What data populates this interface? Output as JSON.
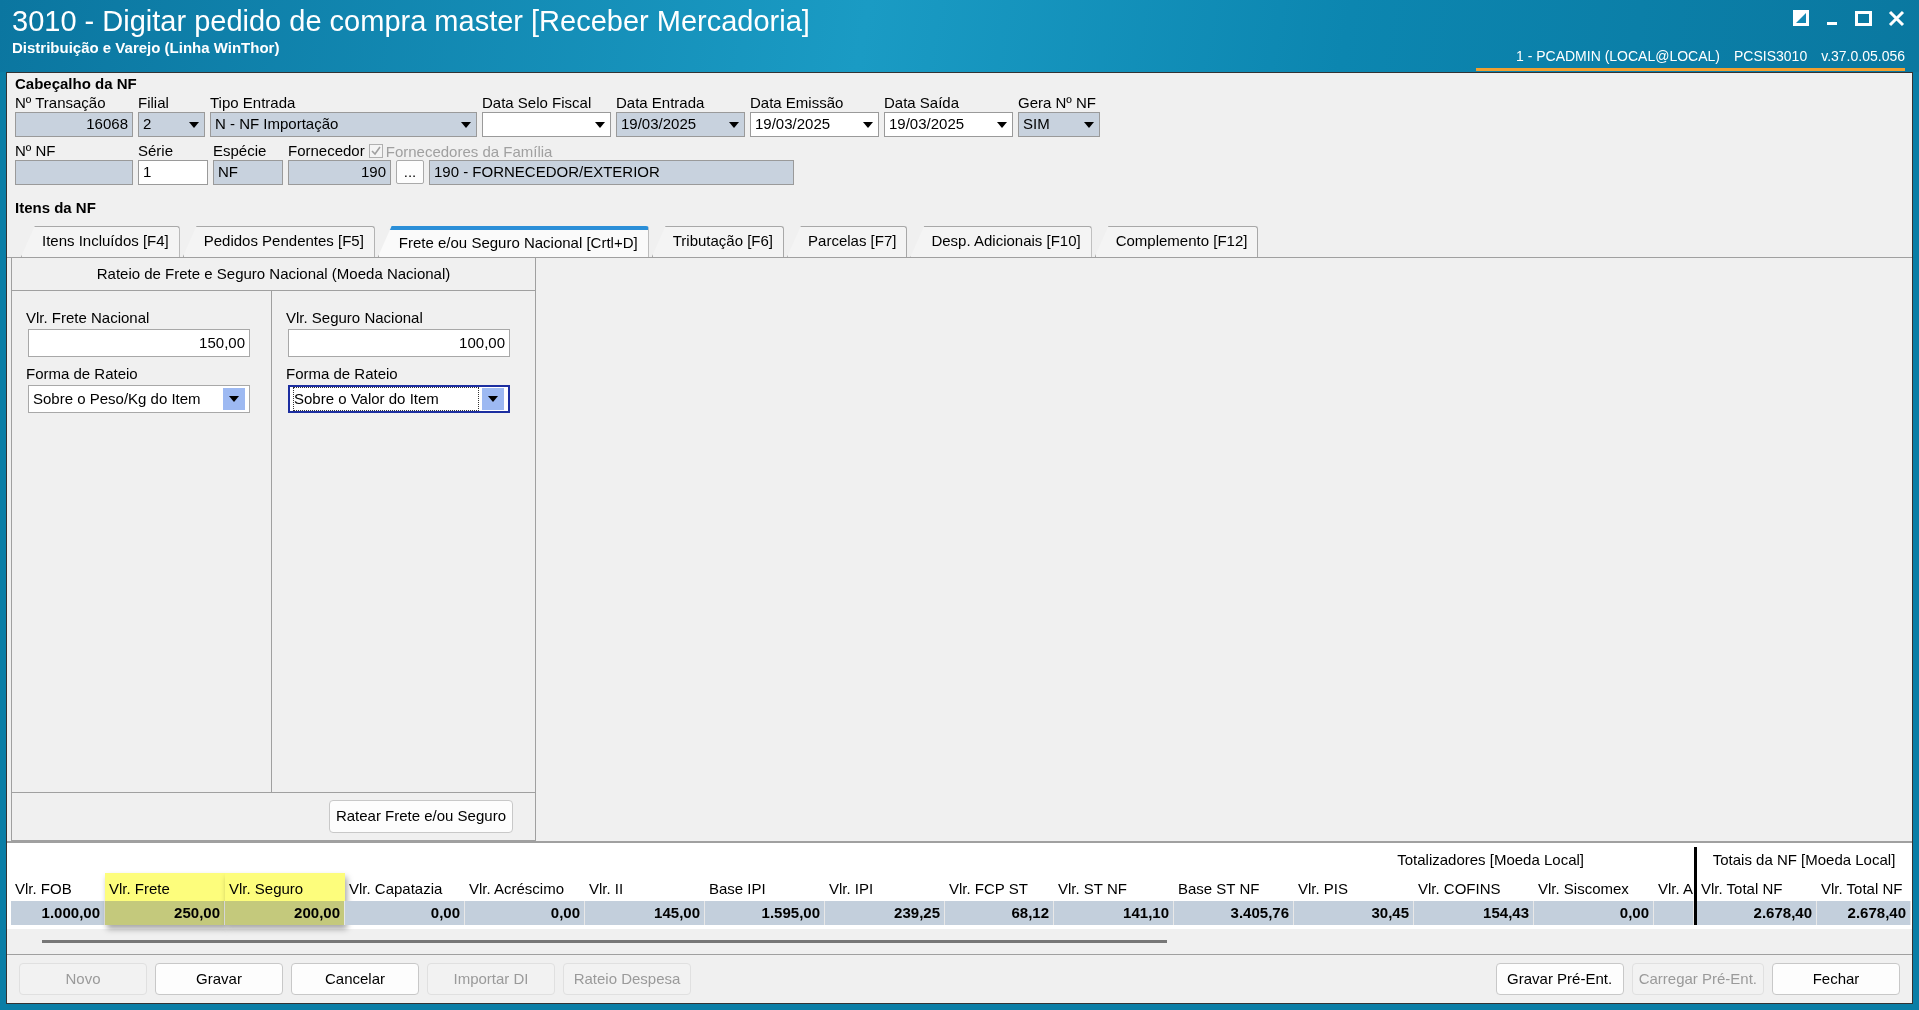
{
  "window": {
    "title": "3010 - Digitar pedido de compra master [Receber Mercadoria]",
    "subtitle": "Distribuição e Varejo (Linha WinThor)",
    "session": "1 - PCADMIN (LOCAL@LOCAL)",
    "program": "PCSIS3010",
    "version": "v.37.0.05.056"
  },
  "header": {
    "title": "Cabeçalho da NF",
    "row_1": [
      {
        "label": "Nº Transação",
        "value": "16068",
        "kind": "number",
        "readonly": true
      },
      {
        "label": "Filial",
        "value": "2",
        "kind": "combo",
        "readonly": true
      },
      {
        "label": "Tipo Entrada",
        "value": "N - NF Importação",
        "kind": "combo",
        "readonly": true
      },
      {
        "label": "Data Selo Fiscal",
        "kind": "combo",
        "readonly": false
      },
      {
        "label": "Data Entrada",
        "value": "19/03/2025",
        "kind": "combo",
        "readonly": true
      },
      {
        "label": "Data Emissão",
        "value": "19/03/2025",
        "kind": "combo",
        "readonly": false
      },
      {
        "label": "Data Saída",
        "value": "19/03/2025",
        "kind": "combo",
        "readonly": false
      },
      {
        "label": "Gera Nº NF",
        "value": "SIM",
        "kind": "combo",
        "readonly": true
      }
    ],
    "row_2": [
      {
        "label": "Nº NF",
        "kind": "text",
        "readonly": true
      },
      {
        "label": "Série",
        "value": "1",
        "kind": "text",
        "readonly": false
      },
      {
        "label": "Espécie",
        "value": "NF",
        "kind": "text",
        "readonly": true
      },
      {
        "label": "Fornecedor",
        "value": "190",
        "kind": "number",
        "readonly": true,
        "checkbox": {
          "label": "Fornecedores da Família",
          "checked": true,
          "disabled": true
        }
      },
      {
        "value": "...",
        "kind": "button"
      },
      {
        "value": "190 - FORNECEDOR/EXTERIOR",
        "kind": "text",
        "readonly": true
      }
    ]
  },
  "items_title": "Itens da NF",
  "tabs": [
    {
      "label": "Itens Incluídos [F4]",
      "selected": false
    },
    {
      "label": "Pedidos Pendentes [F5]",
      "selected": false
    },
    {
      "label": "Frete e/ou Seguro Nacional [Crtl+D]",
      "selected": true
    },
    {
      "label": "Tributação [F6]",
      "selected": false
    },
    {
      "label": "Parcelas [F7]",
      "selected": false
    },
    {
      "label": "Desp. Adicionais [F10]",
      "selected": false
    },
    {
      "label": "Complemento [F12]",
      "selected": false
    }
  ],
  "panel": {
    "title": "Rateio de Frete e Seguro Nacional (Moeda Nacional)",
    "columns": [
      {
        "label": "Vlr. Frete Nacional",
        "value": "150,00",
        "method_label": "Forma de Rateio",
        "method_value": "Sobre o Peso/Kg do Item",
        "focused": false
      },
      {
        "label": "Vlr. Seguro Nacional",
        "value": "100,00",
        "method_label": "Forma de Rateio",
        "method_value": "Sobre o Valor do Item",
        "focused": true
      }
    ],
    "button": "Ratear Frete e/ou Seguro"
  },
  "totals": {
    "groups": [
      {
        "label": "Totalizadores [Moeda Local]",
        "columns": [
          {
            "header": "Vlr. FOB",
            "value": "1.000,00",
            "highlighted": false
          },
          {
            "header": "Vlr. Frete",
            "value": "250,00",
            "highlighted": true
          },
          {
            "header": "Vlr. Seguro",
            "value": "200,00",
            "highlighted": true
          },
          {
            "header": "Vlr. Capatazia",
            "value": "0,00",
            "highlighted": false
          },
          {
            "header": "Vlr. Acréscimo",
            "value": "0,00",
            "highlighted": false
          },
          {
            "header": "Vlr. II",
            "value": "145,00",
            "highlighted": false
          },
          {
            "header": "Base IPI",
            "value": "1.595,00",
            "highlighted": false
          },
          {
            "header": "Vlr. IPI",
            "value": "239,25",
            "highlighted": false
          },
          {
            "header": "Vlr. FCP ST",
            "value": "68,12",
            "highlighted": false
          },
          {
            "header": "Vlr. ST NF",
            "value": "141,10",
            "highlighted": false
          },
          {
            "header": "Base ST NF",
            "value": "3.405,76",
            "highlighted": false
          },
          {
            "header": "Vlr. PIS",
            "value": "30,45",
            "highlighted": false
          },
          {
            "header": "Vlr. COFINS",
            "value": "154,43",
            "highlighted": false
          },
          {
            "header": "Vlr. Siscomex",
            "value": "0,00",
            "highlighted": false
          },
          {
            "header": "Vlr. A",
            "highlighted": false
          }
        ]
      },
      {
        "label": "Totais da NF [Moeda Local]",
        "columns": [
          {
            "header": "Vlr. Total NF",
            "value": "2.678,40",
            "highlighted": false
          },
          {
            "header": "Vlr. Total NF",
            "value": "2.678,40",
            "highlighted": false
          }
        ]
      }
    ]
  },
  "buttons_left": [
    {
      "label": "Novo",
      "disabled": true
    },
    {
      "label": "Gravar",
      "disabled": false
    },
    {
      "label": "Cancelar",
      "disabled": false
    },
    {
      "label": "Importar DI",
      "disabled": true
    },
    {
      "label": "Rateio Despesa",
      "disabled": true
    }
  ],
  "buttons_right": [
    {
      "label": "Gravar Pré-Ent.",
      "disabled": false
    },
    {
      "label": "Carregar Pré-Ent.",
      "disabled": true
    },
    {
      "label": "Fechar",
      "disabled": false
    }
  ]
}
